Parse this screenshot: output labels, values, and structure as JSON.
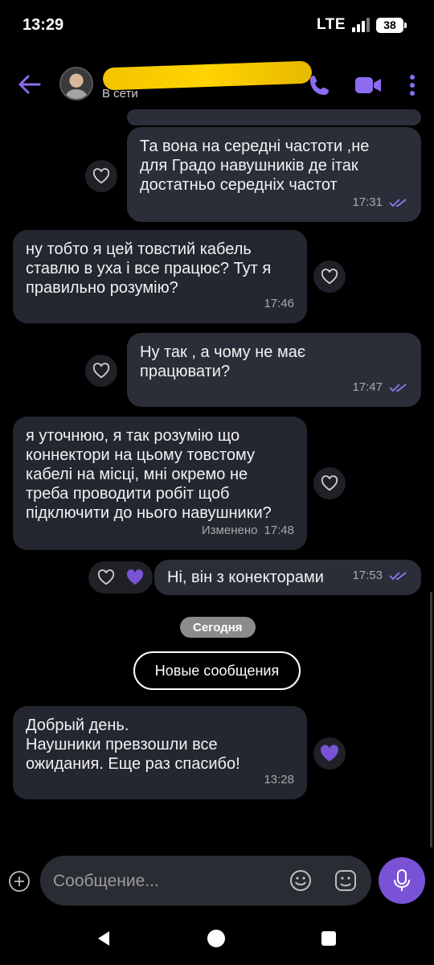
{
  "status": {
    "time": "13:29",
    "network": "LTE",
    "battery": "38"
  },
  "header": {
    "status_text": "В сети"
  },
  "messages": [
    {
      "lines": [
        "Та вона на середні частоти ,не",
        "для Градо навушників де ітак",
        "достатньо середніх частот"
      ],
      "time": "17:31",
      "direction": "out"
    },
    {
      "lines": [
        "ну тобто я цей товстий кабель",
        "ставлю в уха і все працює? Тут я",
        "правильно розумію?"
      ],
      "time": "17:46",
      "direction": "in"
    },
    {
      "lines": [
        "Ну так , а чому не має",
        "працювати?"
      ],
      "time": "17:47",
      "direction": "out"
    },
    {
      "lines": [
        "я уточнюю, я так розумію що",
        "коннектори на цьому товстому",
        "кабелі на місці, мні окремо не",
        "треба проводити робіт щоб",
        "підключити до нього навушники?"
      ],
      "time": "17:48",
      "edited": "Изменено",
      "direction": "in"
    },
    {
      "lines": [
        "Ні, він з конекторами"
      ],
      "time": "17:53",
      "direction": "out"
    },
    {
      "lines": [
        "Добрый день.",
        "Наушники превзошли все",
        "ожидания. Еще раз спасибо!"
      ],
      "time": "13:28",
      "direction": "in"
    }
  ],
  "date_divider": "Сегодня",
  "new_messages_label": "Новые сообщения",
  "composer": {
    "placeholder": "Сообщение..."
  },
  "colors": {
    "accent": "#7a52d6",
    "bubble": "#242730",
    "tick": "#8b7cf0"
  },
  "icons": [
    "back-arrow-icon",
    "call-icon",
    "video-icon",
    "more-icon",
    "heart-icon",
    "heart-filled-icon",
    "plus-icon",
    "emoji-icon",
    "sticker-icon",
    "mic-icon"
  ]
}
